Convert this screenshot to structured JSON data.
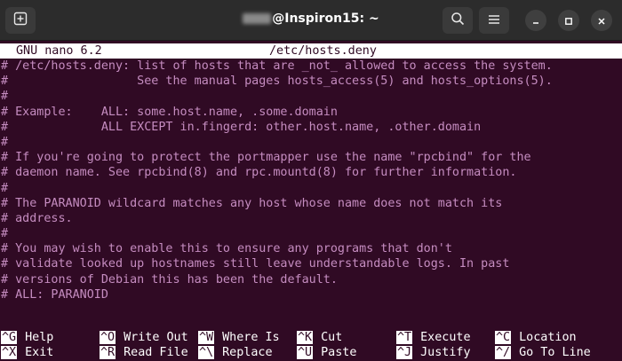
{
  "window": {
    "title_user_redacted": "",
    "title_host": "@Inspiron15: ~"
  },
  "nano": {
    "version": "GNU nano 6.2",
    "filename": "/etc/hosts.deny"
  },
  "file_lines": [
    "# /etc/hosts.deny: list of hosts that are _not_ allowed to access the system.",
    "#                  See the manual pages hosts_access(5) and hosts_options(5).",
    "#",
    "# Example:    ALL: some.host.name, .some.domain",
    "#             ALL EXCEPT in.fingerd: other.host.name, .other.domain",
    "#",
    "# If you're going to protect the portmapper use the name \"rpcbind\" for the",
    "# daemon name. See rpcbind(8) and rpc.mountd(8) for further information.",
    "#",
    "# The PARANOID wildcard matches any host whose name does not match its",
    "# address.",
    "#",
    "# You may wish to enable this to ensure any programs that don't",
    "# validate looked up hostnames still leave understandable logs. In past",
    "# versions of Debian this has been the default.",
    "# ALL: PARANOID"
  ],
  "shortcuts": {
    "row1": [
      {
        "key": "^G",
        "label": "Help"
      },
      {
        "key": "^O",
        "label": "Write Out"
      },
      {
        "key": "^W",
        "label": "Where Is"
      },
      {
        "key": "^K",
        "label": "Cut"
      },
      {
        "key": "^T",
        "label": "Execute"
      },
      {
        "key": "^C",
        "label": "Location"
      }
    ],
    "row2": [
      {
        "key": "^X",
        "label": "Exit"
      },
      {
        "key": "^R",
        "label": "Read File"
      },
      {
        "key": "^\\",
        "label": "Replace"
      },
      {
        "key": "^U",
        "label": "Paste"
      },
      {
        "key": "^J",
        "label": "Justify"
      },
      {
        "key": "^/",
        "label": "Go To Line"
      }
    ]
  },
  "icons": {
    "new_tab": "new-tab-icon",
    "search": "search-icon",
    "menu": "hamburger-menu-icon",
    "minimize": "minimize-icon",
    "maximize": "maximize-icon",
    "close": "close-icon"
  },
  "colors": {
    "terminal_bg": "#300a24",
    "text": "#c58cc0",
    "titlebar_bg": "#2c2c2c"
  }
}
